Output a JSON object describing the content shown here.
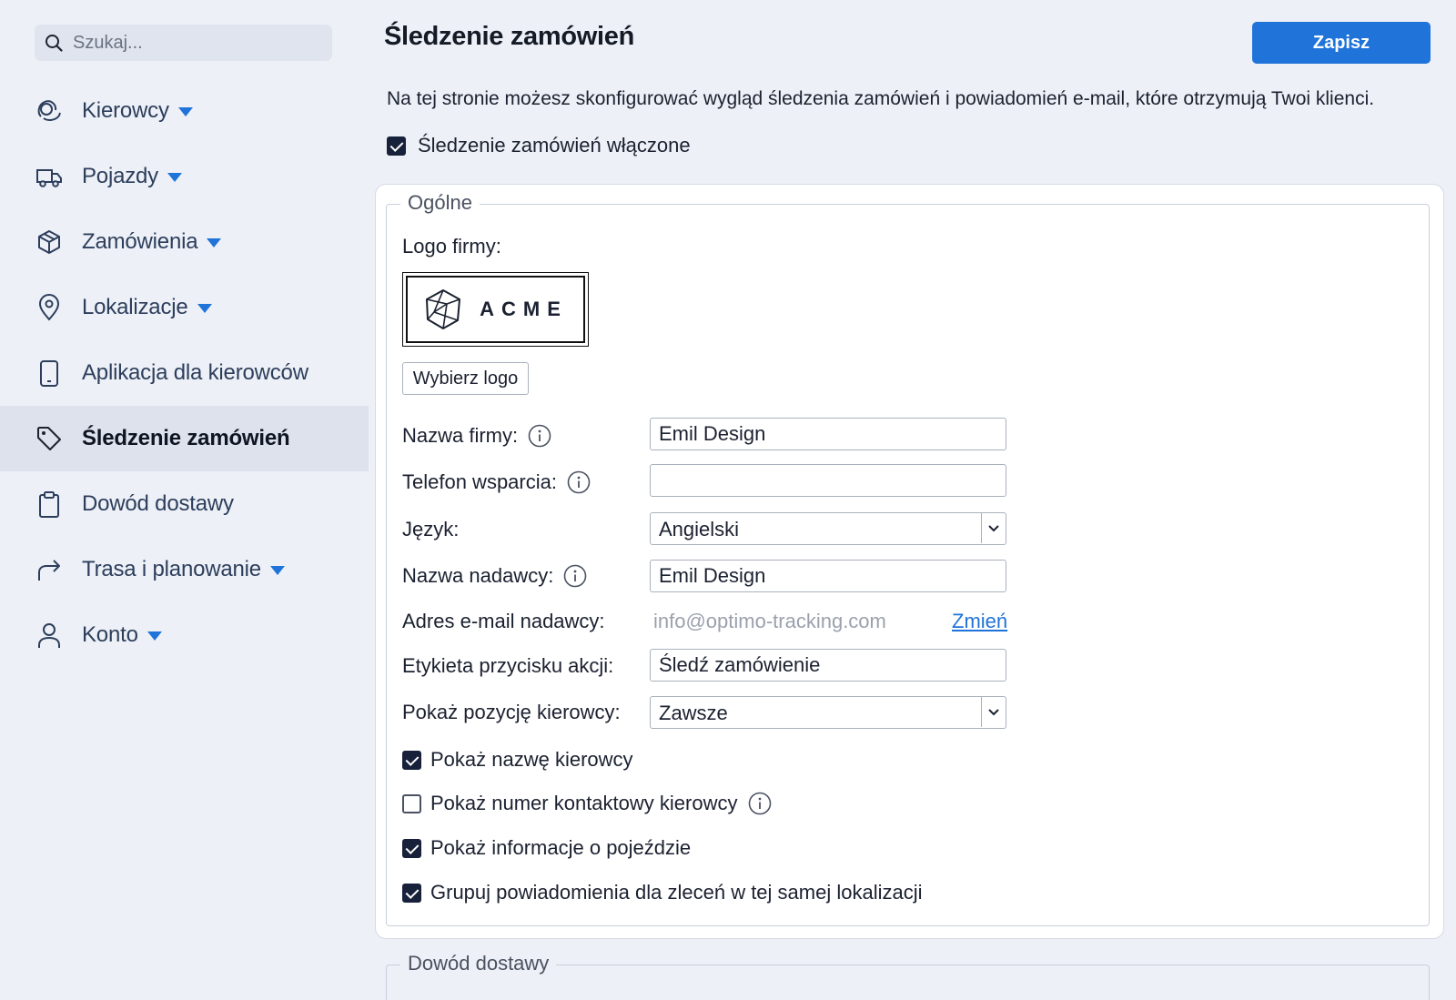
{
  "sidebar": {
    "search_placeholder": "Szukaj...",
    "items": [
      {
        "label": "Kierowcy",
        "icon": "drivers-icon",
        "has_dropdown": true
      },
      {
        "label": "Pojazdy",
        "icon": "truck-icon",
        "has_dropdown": true
      },
      {
        "label": "Zamówienia",
        "icon": "box-icon",
        "has_dropdown": true
      },
      {
        "label": "Lokalizacje",
        "icon": "map-pin-icon",
        "has_dropdown": true
      },
      {
        "label": "Aplikacja dla kierowców",
        "icon": "phone-icon",
        "has_dropdown": false
      },
      {
        "label": "Śledzenie zamówień",
        "icon": "tag-icon",
        "has_dropdown": false,
        "active": true
      },
      {
        "label": "Dowód dostawy",
        "icon": "clipboard-icon",
        "has_dropdown": false
      },
      {
        "label": "Trasa i planowanie",
        "icon": "route-arrow-icon",
        "has_dropdown": true
      },
      {
        "label": "Konto",
        "icon": "user-icon",
        "has_dropdown": true
      }
    ]
  },
  "header": {
    "title": "Śledzenie zamówień",
    "save_label": "Zapisz"
  },
  "intro": "Na tej stronie możesz skonfigurować wygląd śledzenia zamówień i powiadomień e-mail, które otrzymują Twoi klienci.",
  "tracking_enabled": {
    "label": "Śledzenie zamówień włączone",
    "checked": true
  },
  "general": {
    "legend": "Ogólne",
    "logo_label": "Logo firmy:",
    "logo_text": "ACME",
    "choose_logo": "Wybierz logo",
    "company_name": {
      "label": "Nazwa firmy:",
      "value": "Emil Design"
    },
    "support_phone": {
      "label": "Telefon wsparcia:",
      "value": ""
    },
    "language": {
      "label": "Język:",
      "value": "Angielski"
    },
    "sender_name": {
      "label": "Nazwa nadawcy:",
      "value": "Emil Design"
    },
    "sender_email": {
      "label": "Adres e-mail nadawcy:",
      "value": "info@optimo-tracking.com",
      "change_label": "Zmień"
    },
    "action_button": {
      "label": "Etykieta przycisku akcji:",
      "value": "Śledź zamówienie"
    },
    "driver_position": {
      "label": "Pokaż pozycję kierowcy:",
      "value": "Zawsze"
    },
    "checkboxes": [
      {
        "label": "Pokaż nazwę kierowcy",
        "checked": true
      },
      {
        "label": "Pokaż numer kontaktowy kierowcy",
        "checked": false,
        "info": true
      },
      {
        "label": "Pokaż informacje o pojeździe",
        "checked": true
      },
      {
        "label": "Grupuj powiadomienia dla zleceń w tej samej lokalizacji",
        "checked": true
      }
    ]
  },
  "proof_of_delivery": {
    "legend": "Dowód dostawy"
  },
  "colors": {
    "accent": "#1f73d9",
    "sidebar_bg": "#edf0f6",
    "active_item_bg": "#dde2ec"
  }
}
